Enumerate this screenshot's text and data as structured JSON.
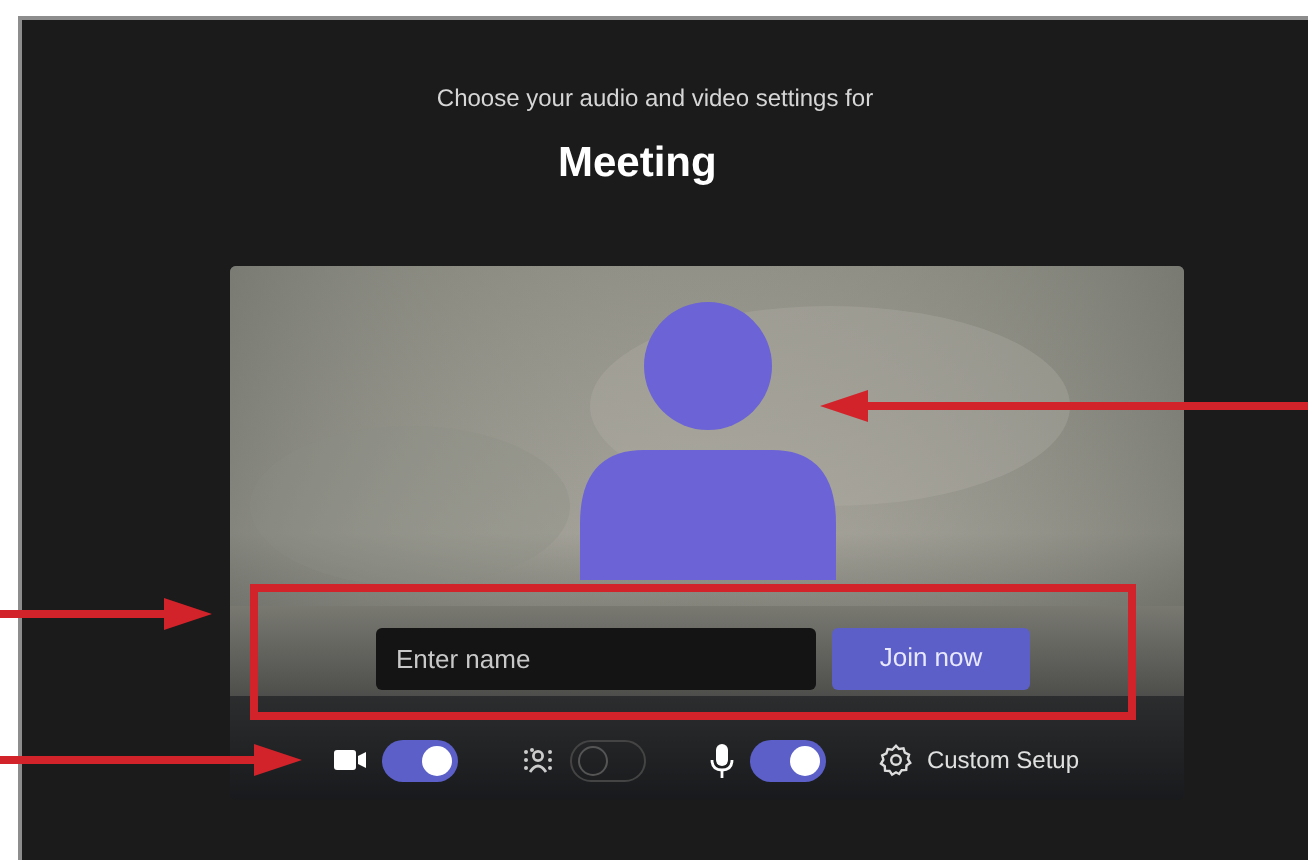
{
  "header": {
    "subtitle": "Choose your audio and video settings for",
    "title": "Meeting"
  },
  "name_field": {
    "placeholder": "Enter name"
  },
  "join_button": {
    "label": "Join now"
  },
  "controls": [
    {
      "kind": "camera",
      "on": true
    },
    {
      "kind": "blur",
      "on": false
    },
    {
      "kind": "mic",
      "on": true
    },
    {
      "kind": "setup",
      "label": "Custom Setup"
    }
  ]
}
